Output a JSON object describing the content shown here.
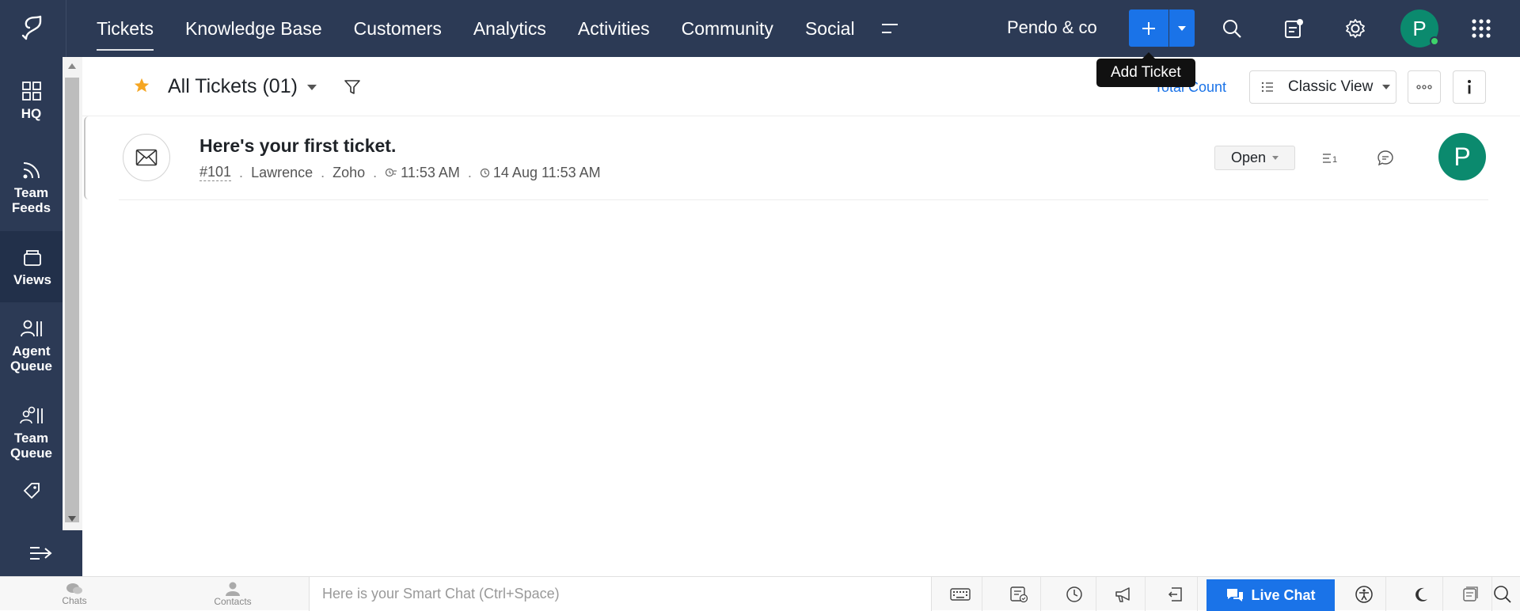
{
  "topnav": {
    "items": [
      {
        "label": "Tickets",
        "active": true
      },
      {
        "label": "Knowledge Base"
      },
      {
        "label": "Customers"
      },
      {
        "label": "Analytics"
      },
      {
        "label": "Activities"
      },
      {
        "label": "Community"
      },
      {
        "label": "Social"
      }
    ],
    "org_name": "Pendo & co",
    "avatar_initial": "P",
    "add_tooltip": "Add Ticket"
  },
  "sidebar": {
    "items": [
      {
        "label": "HQ",
        "icon": "grid-icon"
      },
      {
        "label": "Team Feeds",
        "icon": "feed-icon"
      },
      {
        "label": "Views",
        "icon": "views-icon",
        "active": true
      },
      {
        "label": "Agent Queue",
        "icon": "agent-queue-icon"
      },
      {
        "label": "Team Queue",
        "icon": "team-queue-icon"
      }
    ]
  },
  "view": {
    "title": "All Tickets (01)",
    "total_count_label": "Total Count",
    "view_mode": "Classic View"
  },
  "tickets": [
    {
      "subject": "Here's your first ticket.",
      "id": "#101",
      "contact": "Lawrence",
      "account": "Zoho",
      "response_time": "11:53 AM",
      "due": "14 Aug 11:53 AM",
      "status": "Open",
      "thread_count": "1",
      "assignee_initial": "P"
    }
  ],
  "bottombar": {
    "chats_label": "Chats",
    "contacts_label": "Contacts",
    "smart_chat_placeholder": "Here is your Smart Chat (Ctrl+Space)",
    "live_chat_label": "Live Chat"
  },
  "colors": {
    "topbar": "#2c3a55",
    "accent": "#1a73e8",
    "avatar": "#0b8a6e",
    "star": "#f5a623"
  }
}
